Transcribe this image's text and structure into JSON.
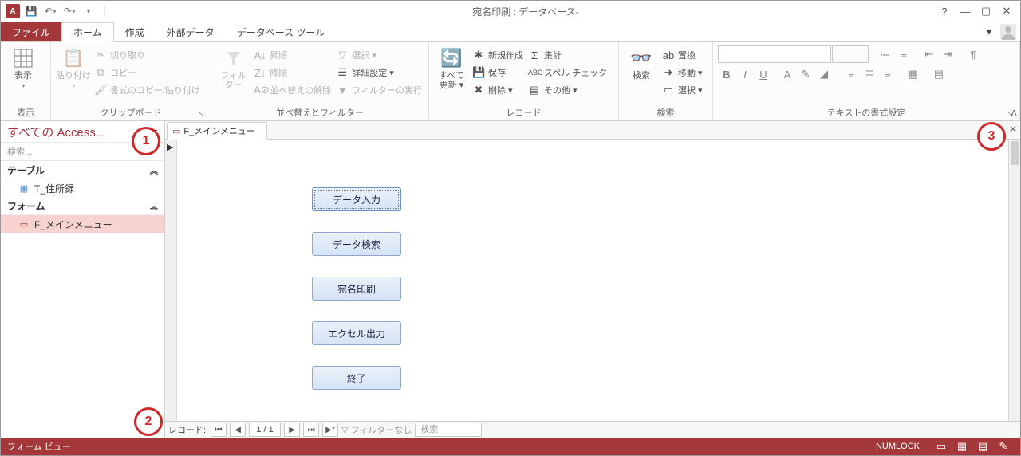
{
  "qat": {
    "title": "宛名印刷 : データベース-",
    "app_letter": "A"
  },
  "tabs": {
    "file": "ファイル",
    "home": "ホーム",
    "create": "作成",
    "external": "外部データ",
    "dbtools": "データベース ツール"
  },
  "ribbon": {
    "view": {
      "label": "表示",
      "group": "表示"
    },
    "clipboard": {
      "paste": "貼り付け",
      "cut": "切り取り",
      "copy": "コピー",
      "fmtpaint": "書式のコピー/貼り付け",
      "group": "クリップボード"
    },
    "sort": {
      "filter": "フィルター",
      "asc": "昇順",
      "desc": "降順",
      "clear": "並べ替えの解除",
      "sel": "選択 ▾",
      "adv": "詳細設定 ▾",
      "toggle": "フィルターの実行",
      "group": "並べ替えとフィルター"
    },
    "records": {
      "refresh": "すべて\n更新 ▾",
      "new": "新規作成",
      "save": "保存",
      "delete": "削除 ▾",
      "totals": "集計",
      "spell": "スペル チェック",
      "more": "その他 ▾",
      "group": "レコード"
    },
    "find": {
      "find": "検索",
      "replace": "置換",
      "goto": "移動 ▾",
      "select": "選択 ▾",
      "group": "検索"
    },
    "format": {
      "group": "テキストの書式設定"
    }
  },
  "nav": {
    "header": "すべての Access...",
    "search_placeholder": "検索...",
    "cat_tables": "テーブル",
    "item_table": "T_住所録",
    "cat_forms": "フォーム",
    "item_form": "F_メインメニュー"
  },
  "doc": {
    "tab": "F_メインメニュー"
  },
  "form_buttons": {
    "b1": "データ入力",
    "b2": "データ検索",
    "b3": "宛名印刷",
    "b4": "エクセル出力",
    "b5": "終了"
  },
  "recnav": {
    "label": "レコード:",
    "pos": "1 / 1",
    "nofilter": "フィルターなし",
    "search": "検索"
  },
  "status": {
    "view": "フォーム ビュー",
    "numlock": "NUMLOCK"
  },
  "callouts": {
    "c1": "1",
    "c2": "2",
    "c3": "3"
  }
}
